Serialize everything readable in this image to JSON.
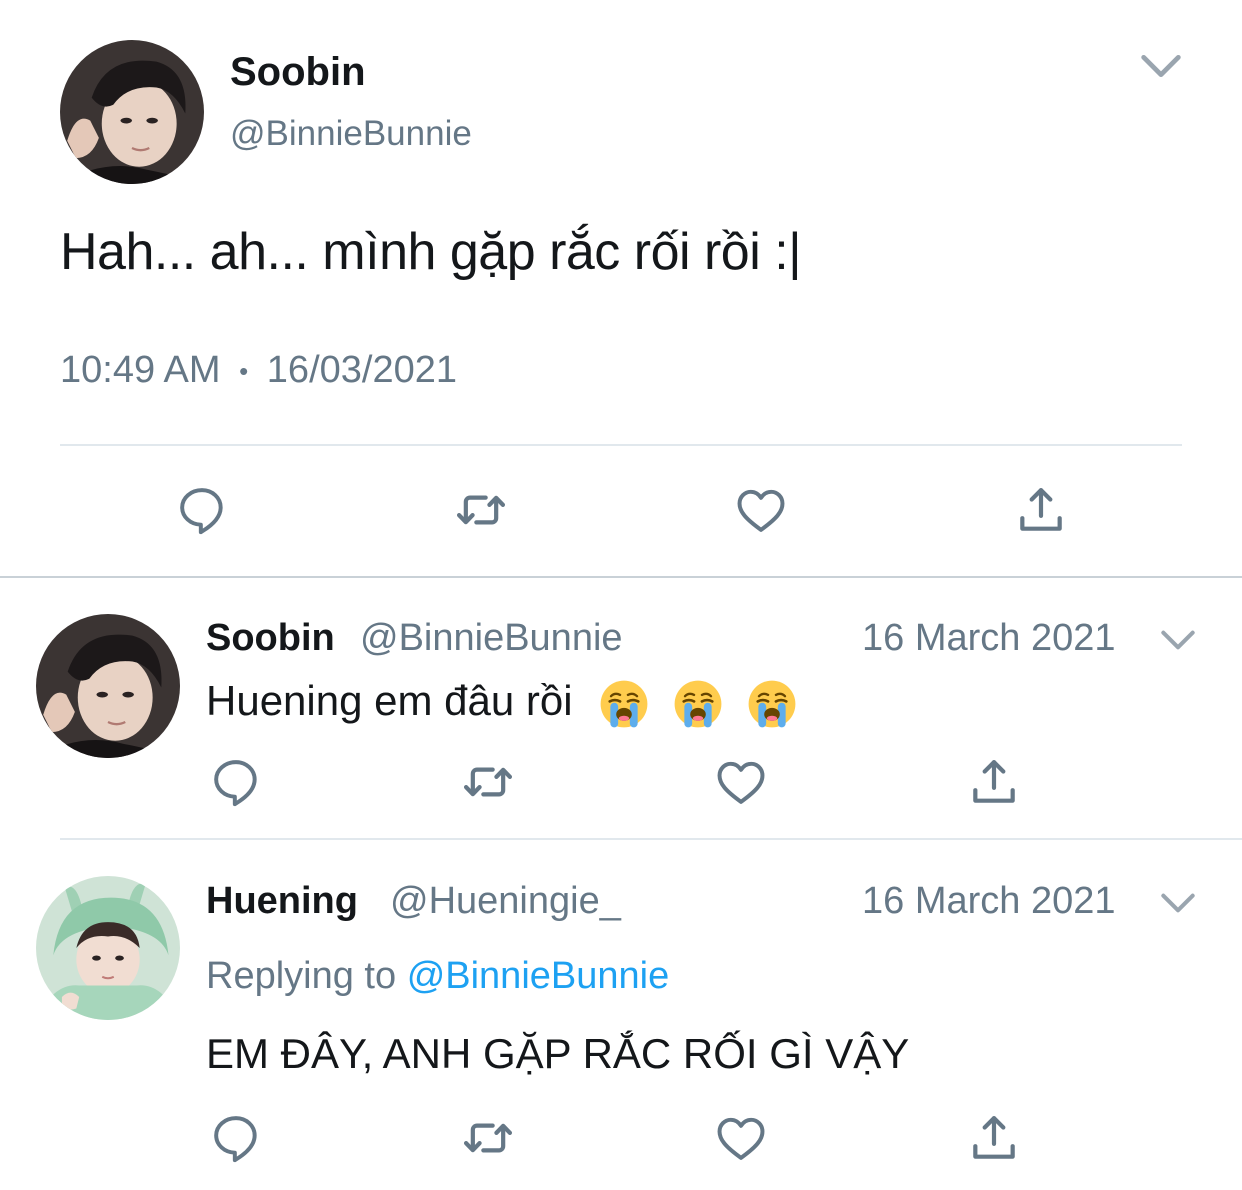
{
  "main_tweet": {
    "name": "Soobin",
    "handle": "@BinnieBunnie",
    "text": "Hah... ah... mình gặp rắc rối rồi :|",
    "time": "10:49 AM",
    "separator": "•",
    "date": "16/03/2021",
    "avatar_icon": "avatar-photo",
    "menu_icon": "chevron-down-icon"
  },
  "replies": [
    {
      "name": "Soobin",
      "handle": "@BinnieBunnie",
      "date": "16 March 2021",
      "text": "Huening em đâu rồi",
      "emoji": [
        "loudly-crying-face-icon",
        "loudly-crying-face-icon",
        "loudly-crying-face-icon"
      ]
    },
    {
      "name": "Huening",
      "handle": "@Hueningie_",
      "date": "16 March 2021",
      "replying_label": "Replying to",
      "replying_to": "@BinnieBunnie",
      "text": "EM ĐÂY, ANH GẶP RẮC RỐI GÌ VẬY"
    }
  ],
  "actions": [
    "reply-icon",
    "retweet-icon",
    "like-icon",
    "share-icon"
  ],
  "colors": {
    "text": "#14171a",
    "secondary": "#657786",
    "link": "#1da1f2",
    "divider": "#e1e8ed"
  }
}
